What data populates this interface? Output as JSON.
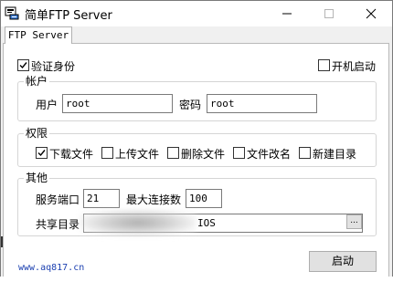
{
  "window": {
    "title": "简单FTP Server"
  },
  "tabs": [
    {
      "label": "FTP Server"
    }
  ],
  "options": {
    "auth_label": "验证身份",
    "auth_checked": true,
    "autostart_label": "开机启动",
    "autostart_checked": false
  },
  "account": {
    "legend": "帐户",
    "user_label": "用户",
    "user_value": "root",
    "password_label": "密码",
    "password_value": "root"
  },
  "permissions": {
    "legend": "权限",
    "items": [
      {
        "label": "下载文件",
        "checked": true
      },
      {
        "label": "上传文件",
        "checked": false
      },
      {
        "label": "删除文件",
        "checked": false
      },
      {
        "label": "文件改名",
        "checked": false
      },
      {
        "label": "新建目录",
        "checked": false
      }
    ]
  },
  "other": {
    "legend": "其他",
    "port_label": "服务端口",
    "port_value": "21",
    "maxconn_label": "最大连接数",
    "maxconn_value": "100",
    "share_label": "共享目录",
    "share_value": "IOS",
    "browse_label": "..."
  },
  "footer": {
    "link_text": "www.aq817.cn",
    "start_label": "启动"
  },
  "colors": {
    "link": "#1a3fb0",
    "window_bg": "#f0f0f0",
    "panel_bg": "#ffffff"
  },
  "icons": {
    "app": "ftp-app-icon",
    "check": "checkmark-icon"
  }
}
